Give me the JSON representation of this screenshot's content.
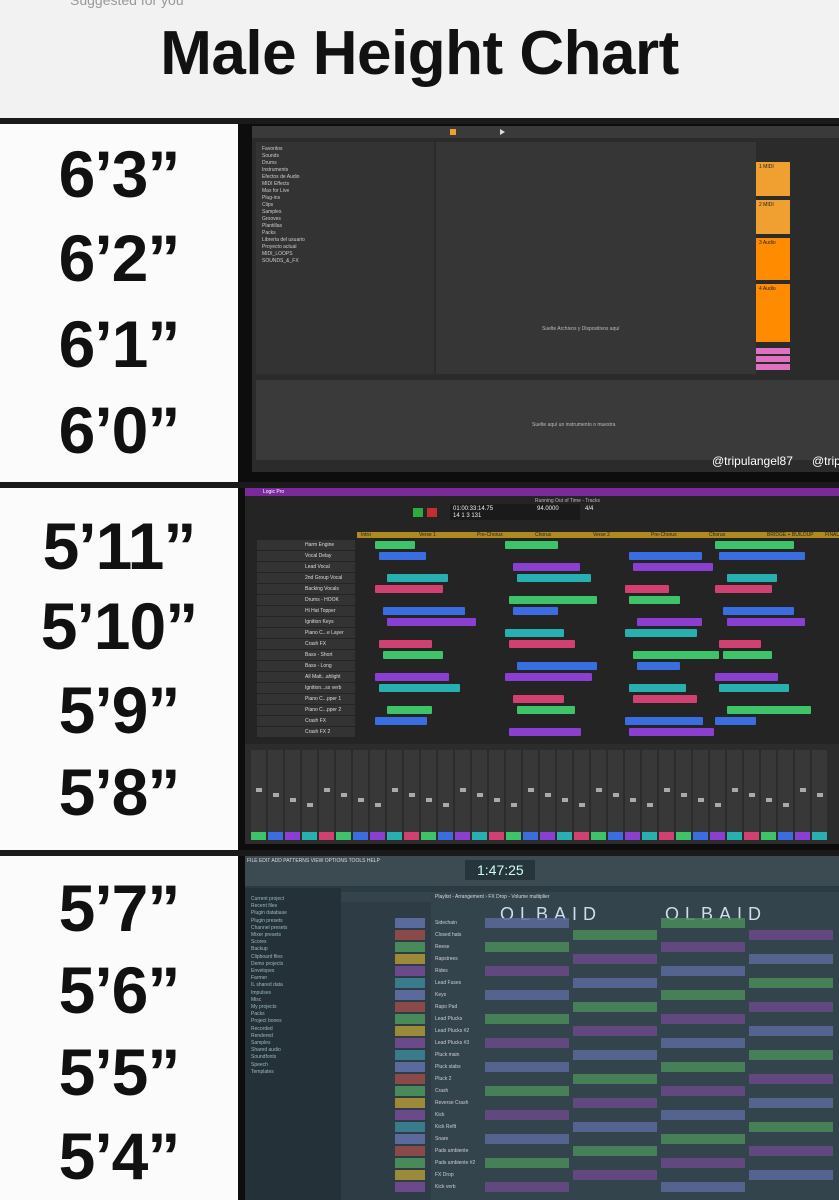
{
  "header": {
    "suggested": "Suggested for you",
    "title": "Male Height Chart"
  },
  "groups": [
    {
      "heights": [
        "6’3”",
        "6’2”",
        "6’1”",
        "6’0”"
      ]
    },
    {
      "heights": [
        "5’11”",
        "5’10”",
        "5’9”",
        "5’8”"
      ]
    },
    {
      "heights": [
        "5’7”",
        "5’6”",
        "5’5”",
        "5’4”"
      ]
    }
  ],
  "ableton": {
    "browser_items": [
      "Favoritos",
      "Sounds",
      "Drums",
      "Instruments",
      "Efectos de Audio",
      "MIDI Effects",
      "Max for Live",
      "Plug-ins",
      "Clips",
      "Samples",
      "Grooves",
      "Plantillas",
      "Packs",
      "Librería del usuario",
      "Proyecto actual",
      "MIDI_LOOPS",
      "SOUNDS_&_FX"
    ],
    "drop_text": "Suelte Archivos y Dispositivos aquí",
    "drop_instrument": "Suelte aquí un instrumento o muestra",
    "tracks": [
      "1 MIDI",
      "2 MIDI",
      "3 Audio",
      "4 Audio",
      "A Reverb",
      "B Delay",
      "Master"
    ],
    "tiktok_handle": "@tripulangel87",
    "insta_handle": "@trip"
  },
  "logic": {
    "menu": [
      "Logic Pro",
      "File",
      "Edit",
      "Track",
      "Navigate",
      "Record",
      "Mix",
      "View",
      "Window",
      "?",
      "Help"
    ],
    "project": "Running Out of Time - Tracks",
    "time": "01:00:33:14.75",
    "bars": "14 1 3 131",
    "tempo": "94.0000",
    "sig": "4/4",
    "tracks": [
      "Harm Engine",
      "Vocal Delay",
      "Lead Vocal",
      "2nd Group Vocal",
      "Backing Vocals",
      "Drums - HOOK",
      "Hi Hat Topper",
      "Ignition Keys",
      "Piano C...e Layer",
      "Crash FX",
      "Bass - Short",
      "Bass - Long",
      "All Matt...ahlight",
      "Ignition...ss verb",
      "Piano C...pper 1",
      "Piano C...pper 2",
      "Crash FX",
      "Crash FX 2"
    ],
    "sections": [
      "Intro",
      "Verse 1",
      "Pre-Chorus",
      "Chorus",
      "Verse 2",
      "Pre-Chorus",
      "Chorus",
      "BRIDGE + BUILDUP",
      "FINAL CHORUS"
    ]
  },
  "flstudio": {
    "menu": "FILE EDIT ADD PATTERNS VIEW OPTIONS TOOLS HELP",
    "time": "1:47:25",
    "playlist_title": "Playlist - Arrangement › FX Drop - Volume multiplier",
    "logo_text": "OLBAID",
    "browser": [
      "Current project",
      "Recent files",
      "Plugin database",
      "Plugin presets",
      "Channel presets",
      "Mixer presets",
      "Scores",
      "Backup",
      "Clipboard files",
      "Demo projects",
      "Envelopes",
      "Farmer",
      "IL shared data",
      "Impulses",
      "Misc",
      "My projects",
      "Packs",
      "Project bones",
      "Recorded",
      "Rendered",
      "Samples",
      "Shared audio",
      "Soundfonts",
      "Speech",
      "Templates"
    ],
    "channels": [
      "Sidechain",
      "Closed hats",
      "Reese",
      "Rapstrees",
      "Rides",
      "Lead Fuses",
      "Keys",
      "Rapo Pad",
      "Lead Plucks",
      "Lead Plucks #2",
      "Lead Plucks #3",
      "Pluck main",
      "Pluck stabs",
      "Pluck 2",
      "Crash",
      "Reverse Crash",
      "Kick",
      "Kick Reflt",
      "Snare",
      "Pads ambiente",
      "Pads ambiente #2",
      "FX Drop",
      "Kick verb"
    ]
  },
  "colors": {
    "ableton_orange": "#f0a030",
    "logic_green": "#3ec26a",
    "logic_blue": "#3a6ee0",
    "logic_purple": "#8a3fd0",
    "fl_bg": "#2a3b44"
  }
}
